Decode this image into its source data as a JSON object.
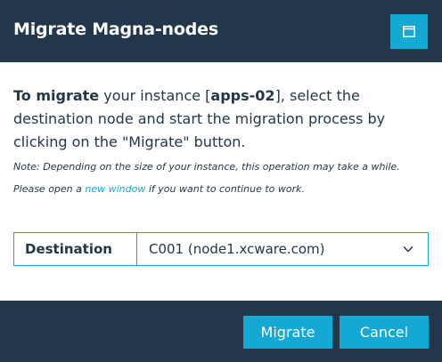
{
  "header": {
    "title": "Migrate Magna-nodes",
    "window_icon": "window-icon"
  },
  "intro": {
    "bold_prefix": "To migrate",
    "text_before_instance": " your instance [",
    "instance": "apps-02",
    "text_after_instance": "], select the destination node and start the migration process by clicking on the \"Migrate\" button."
  },
  "note": {
    "text_before_link": "Note: Depending on the size of your instance, this operation may take a while. Please open a ",
    "link_text": "new window",
    "text_after_link": " if you want to continue to work."
  },
  "destination": {
    "label": "Destination",
    "selected_value": "C001 (node1.xcware.com)",
    "dropdown_icon": "chevron-down-icon"
  },
  "footer": {
    "migrate_label": "Migrate",
    "cancel_label": "Cancel"
  },
  "colors": {
    "dark": "#24374a",
    "accent": "#14a8d4",
    "text": "#24374a"
  }
}
